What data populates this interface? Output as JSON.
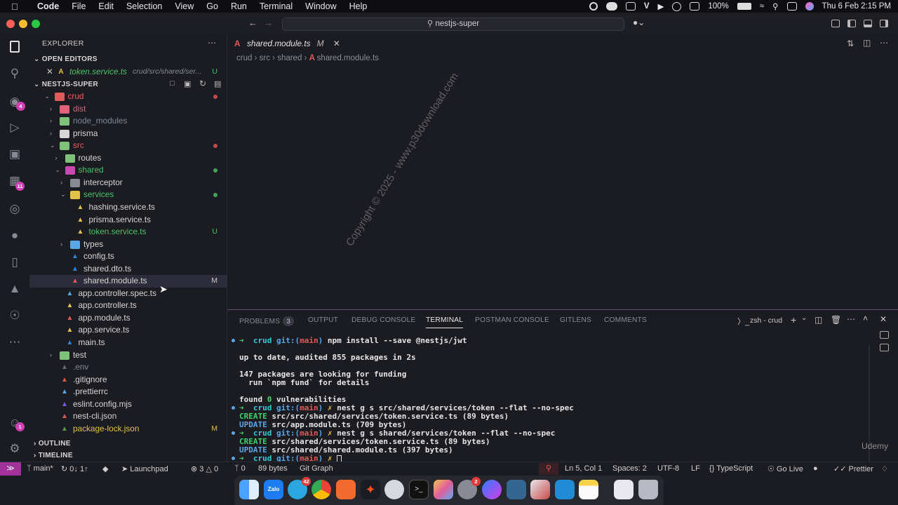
{
  "menubar": {
    "app": "Code",
    "items": [
      "File",
      "Edit",
      "Selection",
      "View",
      "Go",
      "Run",
      "Terminal",
      "Window",
      "Help"
    ],
    "battery": "100%",
    "datetime": "Thu 6 Feb  2:15 PM"
  },
  "titlebar": {
    "command_center": "nestjs-super"
  },
  "activity": {
    "scm_badge": "4",
    "extensions_badge": "11",
    "accounts_badge": "1"
  },
  "sidebar": {
    "title": "EXPLORER",
    "open_editors_label": "OPEN EDITORS",
    "open_editor": {
      "name": "token.service.ts",
      "path": "crud/src/shared/ser...",
      "status": "U"
    },
    "project_label": "NESTJS-SUPER",
    "tree": [
      {
        "name": "crud",
        "color": "#f05a5a"
      },
      {
        "name": "dist",
        "color": "#c26b7a"
      },
      {
        "name": "node_modules",
        "color": "#7d8a96"
      },
      {
        "name": "prisma",
        "color": "#d6d6d6"
      },
      {
        "name": "src",
        "color": "#f05a5a"
      },
      {
        "name": "routes",
        "color": "#d6d6d6"
      },
      {
        "name": "shared",
        "color": "#46c46a"
      },
      {
        "name": "interceptor",
        "color": "#d6d6d6"
      },
      {
        "name": "services",
        "color": "#46c46a"
      },
      {
        "name": "hashing.service.ts",
        "color": "#d6d6d6"
      },
      {
        "name": "prisma.service.ts",
        "color": "#d6d6d6"
      },
      {
        "name": "token.service.ts",
        "color": "#46c46a",
        "status": "U"
      },
      {
        "name": "types",
        "color": "#d6d6d6"
      },
      {
        "name": "config.ts",
        "color": "#d6d6d6"
      },
      {
        "name": "shared.dto.ts",
        "color": "#d6d6d6"
      },
      {
        "name": "shared.module.ts",
        "color": "#d6d6d6",
        "status": "M"
      },
      {
        "name": "app.controller.spec.ts",
        "color": "#d6d6d6"
      },
      {
        "name": "app.controller.ts",
        "color": "#d6d6d6"
      },
      {
        "name": "app.module.ts",
        "color": "#d6d6d6"
      },
      {
        "name": "app.service.ts",
        "color": "#d6d6d6"
      },
      {
        "name": "main.ts",
        "color": "#d6d6d6"
      },
      {
        "name": "test",
        "color": "#d6d6d6"
      },
      {
        "name": ".env",
        "color": "#7d8a96"
      },
      {
        "name": ".gitignore",
        "color": "#d6d6d6"
      },
      {
        "name": ".prettierrc",
        "color": "#d6d6d6"
      },
      {
        "name": "eslint.config.mjs",
        "color": "#d6d6d6"
      },
      {
        "name": "nest-cli.json",
        "color": "#d6d6d6"
      },
      {
        "name": "package-lock.json",
        "color": "#e2c14a",
        "status": "M"
      }
    ],
    "outline_label": "OUTLINE",
    "timeline_label": "TIMELINE"
  },
  "editor": {
    "tab_label": "shared.module.ts",
    "tab_status": "M",
    "breadcrumb": [
      "crud",
      "src",
      "shared",
      "shared.module.ts"
    ],
    "watermark": "Copyright © 2025 - www.p30download.com"
  },
  "panel": {
    "tabs": [
      "PROBLEMS",
      "OUTPUT",
      "DEBUG CONSOLE",
      "TERMINAL",
      "POSTMAN CONSOLE",
      "GITLENS",
      "COMMENTS"
    ],
    "problems_count": "3",
    "active_tab": "TERMINAL",
    "shell_label": "zsh - crud",
    "udemy": "Udemy",
    "terminal": {
      "prompt_dir": "crud",
      "prompt_git": "git:(",
      "prompt_branch": "main",
      "prompt_close": ")",
      "x": "✗",
      "cmd1": "npm install --save @nestjs/jwt",
      "out1": "up to date, audited 855 packages in 2s",
      "out2": "147 packages are looking for funding",
      "out3": "  run `npm fund` for details",
      "out4a": "found ",
      "out4b": "0",
      "out4c": " vulnerabilities",
      "cmd2": "nest g s src/shared/services/token --flat --no-spec",
      "create_label": "CREATE",
      "update_label": "UPDATE",
      "out5": "src/src/shared/services/token.service.ts (89 bytes)",
      "out6": "src/app.module.ts (709 bytes)",
      "cmd3": "nest g s shared/services/token --flat --no-spec",
      "out7": "src/shared/services/token.service.ts (89 bytes)",
      "out8": "src/shared/shared.module.ts (397 bytes)"
    }
  },
  "statusbar": {
    "branch": "main*",
    "sync": "0↓ 1↑",
    "launchpad": "Launchpad",
    "errors": "3",
    "warnings": "0",
    "ports": "0",
    "size": "89 bytes",
    "git_graph": "Git Graph",
    "position": "Ln 5, Col 1",
    "spaces": "Spaces: 2",
    "encoding": "UTF-8",
    "eol": "LF",
    "language": "TypeScript",
    "go_live": "Go Live",
    "prettier": "Prettier"
  },
  "dock": {
    "telegram_badge": "42",
    "chrome_badge": "",
    "settings_badge": "2"
  }
}
